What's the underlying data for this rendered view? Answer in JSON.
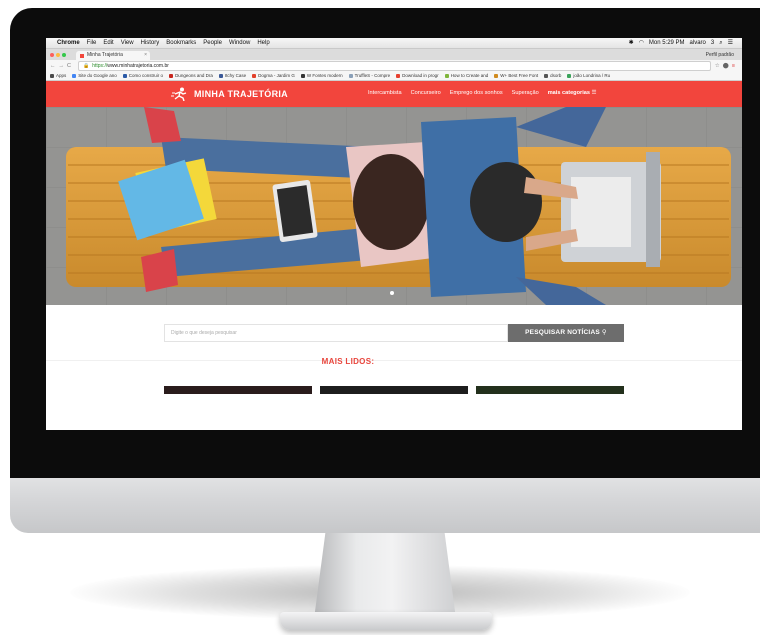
{
  "menubar": {
    "app_name": "Chrome",
    "items": [
      "File",
      "Edit",
      "View",
      "History",
      "Bookmarks",
      "People",
      "Window",
      "Help"
    ],
    "clock": "Mon 5:29 PM",
    "user": "alvaro",
    "user_suffix": "3"
  },
  "browser": {
    "tab_title": "Minha Trajetória",
    "profile": "Perfil padrão",
    "url_scheme": "https://",
    "url_rest": "www.minhatrajetoria.com.br",
    "bookmarks": [
      {
        "label": "Apps",
        "color": "#4a4a4a"
      },
      {
        "label": "Site do Google ano",
        "color": "#4285f4"
      },
      {
        "label": "Como construir o",
        "color": "#2b5aa7"
      },
      {
        "label": "Dungeons and Dra",
        "color": "#c8261e"
      },
      {
        "label": "Itchy Case",
        "color": "#3b5998"
      },
      {
        "label": "Dogma - Jardim G",
        "color": "#e2402a"
      },
      {
        "label": "W Fontes modern",
        "color": "#333333"
      },
      {
        "label": "TruffleS - Compre",
        "color": "#8aa0b8"
      },
      {
        "label": "Download in progr",
        "color": "#e6402f"
      },
      {
        "label": "How to Create and",
        "color": "#7fb53b"
      },
      {
        "label": "W+ Best Free Font",
        "color": "#d08a1e"
      },
      {
        "label": "dsorb",
        "color": "#555555"
      },
      {
        "label": "joão Londrina / Ru",
        "color": "#3aa35a"
      }
    ]
  },
  "site": {
    "logo_text": "MINHA TRAJETÓRIA",
    "nav": [
      "Intercambista",
      "Concurseiro",
      "Emprego dos sonhos",
      "Superação"
    ],
    "nav_more": "mais categorias ☰",
    "search_placeholder": "Digite o que deseja pesquisar",
    "search_button": "PESQUISAR NOTÍCIAS",
    "search_icon_glyph": "⚲",
    "section_title": "MAIS LIDOS:",
    "brand_color": "#f2453d"
  }
}
